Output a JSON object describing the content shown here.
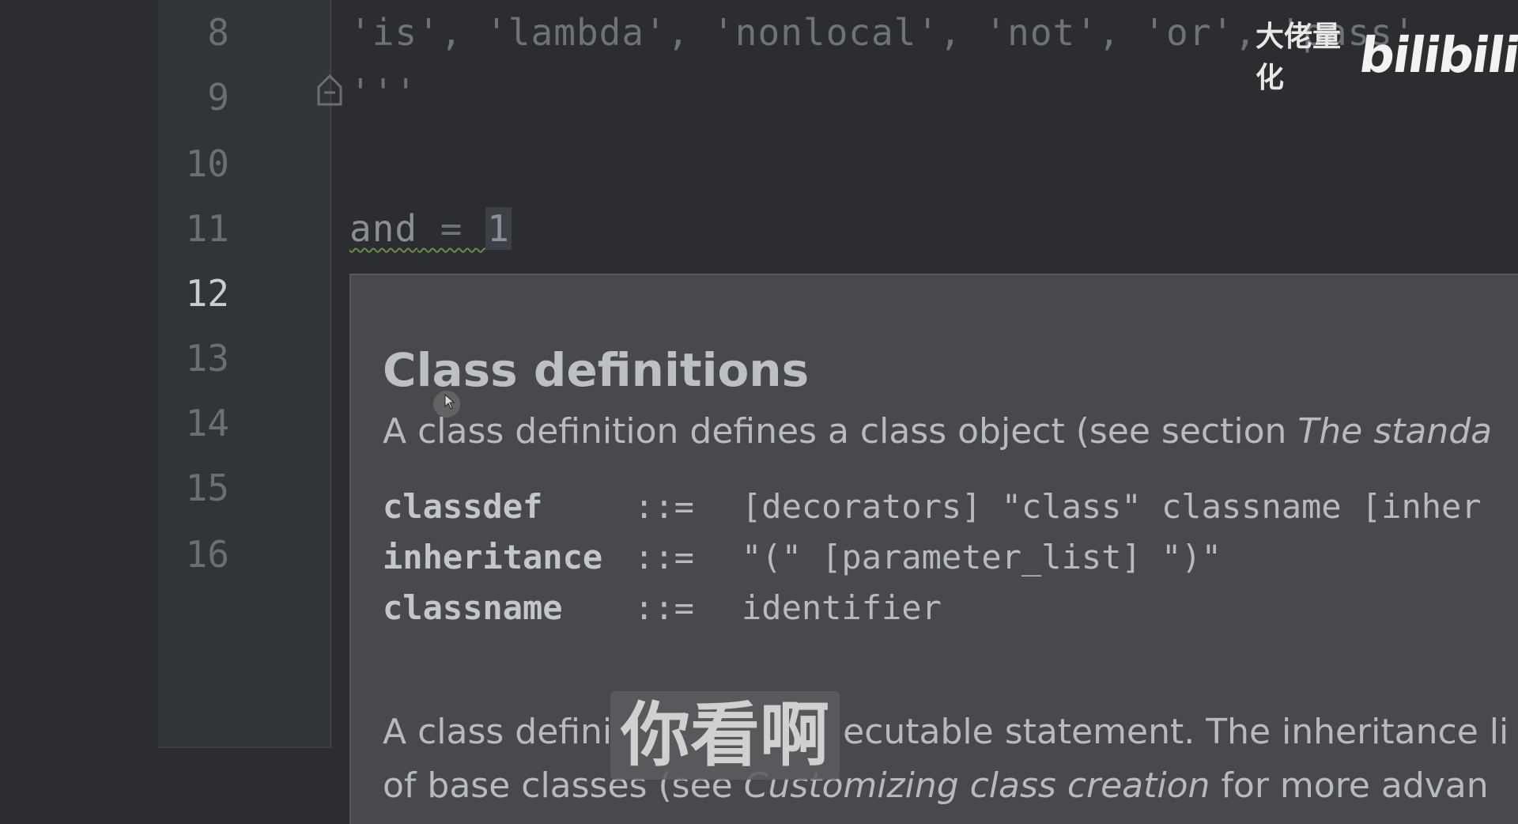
{
  "editor": {
    "line_numbers": [
      "8",
      "9",
      "10",
      "11",
      "12",
      "13",
      "14",
      "15",
      "16"
    ],
    "active_line": "12",
    "code_lines": {
      "line8": "'is', 'lambda', 'nonlocal', 'not', 'or', 'pass'",
      "line9": "'''",
      "line11_ident": "and",
      "line11_op": " = ",
      "line11_value": "1"
    }
  },
  "doc_popup": {
    "title": "Class definitions",
    "intro_prefix": "A class definition defines a class object (see section ",
    "intro_italic": "The standa",
    "grammar": [
      {
        "term": "classdef",
        "op": "::=",
        "rule": "[decorators] \"class\" classname [inher"
      },
      {
        "term": "inheritance",
        "op": "::=",
        "rule": "\"(\" [parameter_list] \")\""
      },
      {
        "term": "classname",
        "op": "::=",
        "rule": "identifier"
      }
    ],
    "para2_line1_start": "A class defini",
    "para2_line1_end": "ecutable statement. The inheritance li",
    "para2_line2_start": "of base classes (see ",
    "para2_line2_italic": "Customizing class creation",
    "para2_line2_end": " for more advan"
  },
  "overlay": {
    "subtitle": "你看啊",
    "watermark_text": "大佬量化",
    "watermark_logo": "bilibili"
  }
}
